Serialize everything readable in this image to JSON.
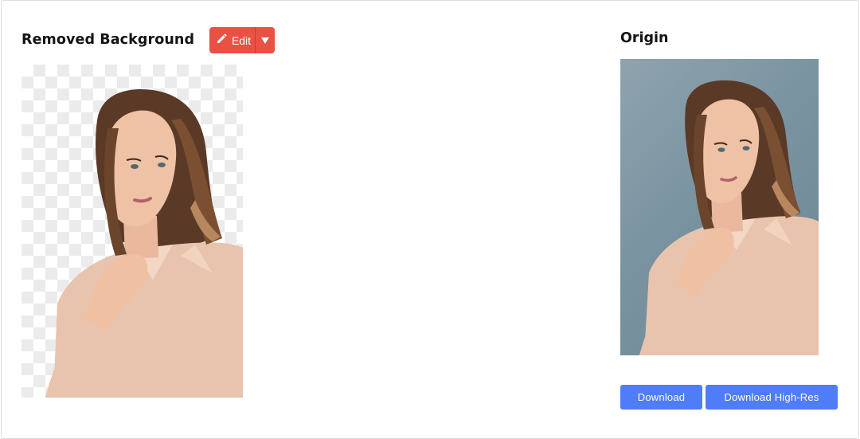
{
  "result": {
    "title": "Removed Background",
    "edit_label": "Edit"
  },
  "origin": {
    "title": "Origin"
  },
  "actions": {
    "download_label": "Download",
    "download_hr_label": "Download High-Res"
  },
  "colors": {
    "edit_button": "#e95243",
    "download_button": "#4f7cf7"
  },
  "icons": {
    "edit": "pencil-icon",
    "dropdown": "caret-down-icon"
  }
}
